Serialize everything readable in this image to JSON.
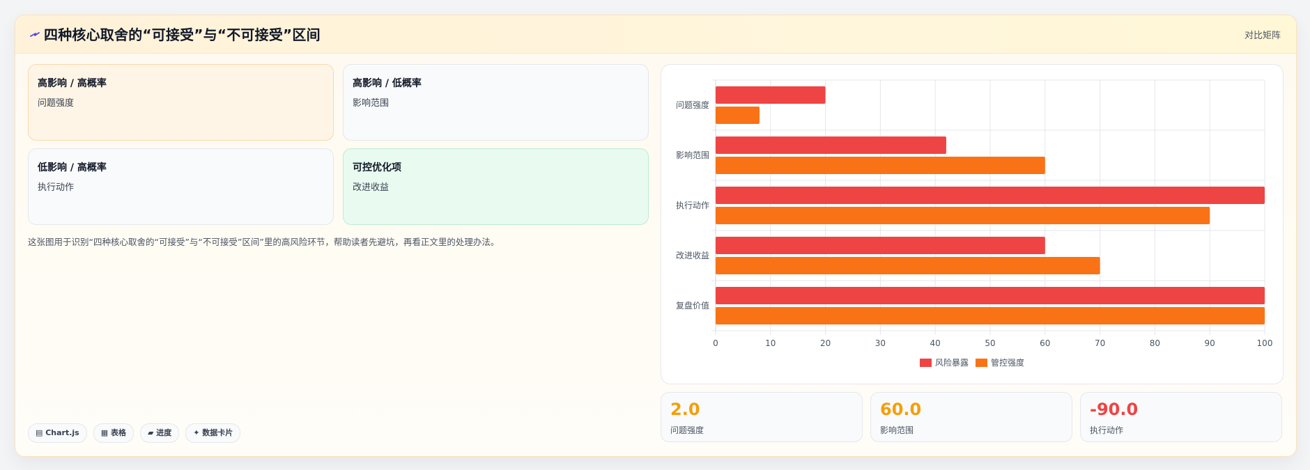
{
  "header": {
    "title": "四种核心取舍的“可接受”与“不可接受”区间",
    "action": "对比矩阵",
    "icon": "pointer-icon"
  },
  "quadrants": [
    {
      "title": "高影响 / 高概率",
      "subtitle": "问题强度"
    },
    {
      "title": "高影响 / 低概率",
      "subtitle": "影响范围"
    },
    {
      "title": "低影响 / 高概率",
      "subtitle": "执行动作"
    },
    {
      "title": "可控优化项",
      "subtitle": "改进收益"
    }
  ],
  "description": "这张图用于识别“四种核心取舍的“可接受”与“不可接受”区间”里的高风险环节，帮助读者先避坑，再看正文里的处理办法。",
  "tags": [
    "▤ Chart.js",
    "▦ 表格",
    "▰ 进度",
    "✦ 数据卡片"
  ],
  "chart_data": {
    "type": "bar",
    "orientation": "horizontal",
    "categories": [
      "问题强度",
      "影响范围",
      "执行动作",
      "改进收益",
      "复盘价值"
    ],
    "series": [
      {
        "name": "风险暴露",
        "values": [
          20,
          42,
          100,
          60,
          100
        ],
        "color": "#ef4444"
      },
      {
        "name": "管控强度",
        "values": [
          8,
          60,
          90,
          70,
          100
        ],
        "color": "#f97316"
      }
    ],
    "xlim": [
      0,
      100
    ],
    "xticks": [
      "0",
      "10",
      "20",
      "30",
      "40",
      "50",
      "60",
      "70",
      "80",
      "90",
      "100"
    ],
    "grid": true,
    "legend": "bottom"
  },
  "stats": [
    {
      "value": "2.0",
      "label": "问题强度",
      "color": "#f59e0b"
    },
    {
      "value": "60.0",
      "label": "影响范围",
      "color": "#f59e0b"
    },
    {
      "value": "-90.0",
      "label": "执行动作",
      "color": "#ef4444"
    }
  ]
}
